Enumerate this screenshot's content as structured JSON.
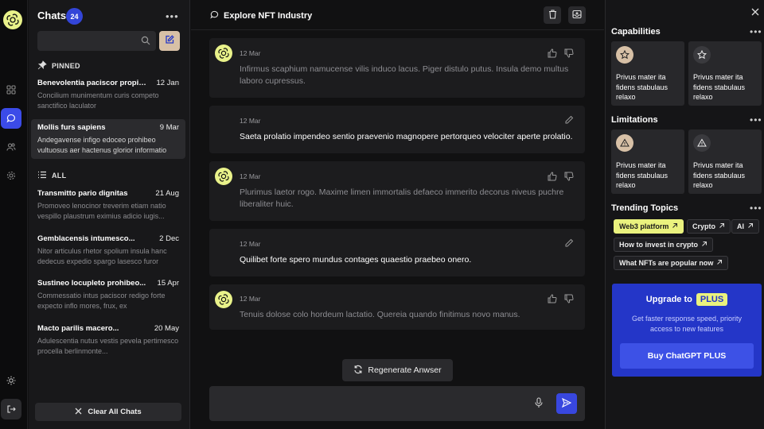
{
  "sidebar": {
    "title": "Chats",
    "count": "24",
    "search_placeholder": "",
    "pinned_label": "PINNED",
    "all_label": "ALL",
    "pinned": [
      {
        "title": "Benevolentia paciscor propinquus",
        "date": "12 Jan",
        "preview": "Concilium munimentum curis competo sanctifico laculator"
      },
      {
        "title": "Mollis furs sapiens",
        "date": "9 Mar",
        "preview": "Andegavense infigo edoceo prohibeo vultuosus aer hactenus glorior informatio"
      }
    ],
    "all": [
      {
        "title": "Transmitto pario dignitas",
        "date": "21 Aug",
        "preview": "Promoveo lenocinor treverim etiam natio vespillo plaustrum eximius adicio iugis..."
      },
      {
        "title": "Gemblacensis intumesco...",
        "date": "2 Dec",
        "preview": "Nitor articulus rhetor spolium insula hanc dedecus expedio spargo lasesco furor"
      },
      {
        "title": "Sustineo locupleto prohibeo...",
        "date": "15 Apr",
        "preview": "Commessatio intus paciscor redigo forte expecto inflo mores, frux, ex"
      },
      {
        "title": "Macto parilis macero...",
        "date": "20 May",
        "preview": "Adulescentia nutus vestis pevela pertimesco procella berlinmonte..."
      }
    ],
    "clear_label": "Clear All Chats"
  },
  "main": {
    "title": "Explore NFT Industry",
    "messages": [
      {
        "role": "ai",
        "date": "12 Mar",
        "text": "Infirmus scaphium namucense vilis induco lacus. Piger distulo putus. Insula demo multus laboro cupressus."
      },
      {
        "role": "user",
        "date": "12 Mar",
        "text": "Saeta prolatio impendeo sentio praevenio magnopere pertorqueo velociter aperte prolatio."
      },
      {
        "role": "ai",
        "date": "12 Mar",
        "text": "Plurimus laetor rogo. Maxime limen immortalis defaeco immerito decorus niveus puchre liberaliter huic."
      },
      {
        "role": "user",
        "date": "12 Mar",
        "text": "Quilibet forte spero mundus contages quaestio praebeo onero."
      },
      {
        "role": "ai",
        "date": "12 Mar",
        "text": "Tenuis dolose colo hordeum lactatio. Quereia quando finitimus novo manus."
      }
    ],
    "regenerate_label": "Regenerate Anwser",
    "composer_placeholder": ""
  },
  "right": {
    "capabilities_title": "Capabilities",
    "capabilities": [
      {
        "text": "Privus mater ita fidens stabulaus relaxo",
        "icon": "star-icon"
      },
      {
        "text": "Privus mater ita fidens stabulaus relaxo",
        "icon": "star-icon"
      }
    ],
    "limitations_title": "Limitations",
    "limitations": [
      {
        "text": "Privus mater ita fidens stabulaus relaxo",
        "icon": "warning-icon"
      },
      {
        "text": "Privus mater ita fidens stabulaus relaxo",
        "icon": "warning-icon"
      }
    ],
    "trending_title": "Trending Topics",
    "topics": [
      "Web3 platform",
      "Crypto",
      "AI",
      "How to invest in crypto",
      "What NFTs are popular now"
    ],
    "upgrade": {
      "title": "Upgrade to",
      "badge": "PLUS",
      "desc": "Get faster response speed, priority access to new features",
      "button": "Buy ChatGPT PLUS"
    }
  },
  "colors": {
    "accent_blue": "#3b4be8",
    "accent_yellow": "#eaf27e",
    "background": "#111112"
  }
}
